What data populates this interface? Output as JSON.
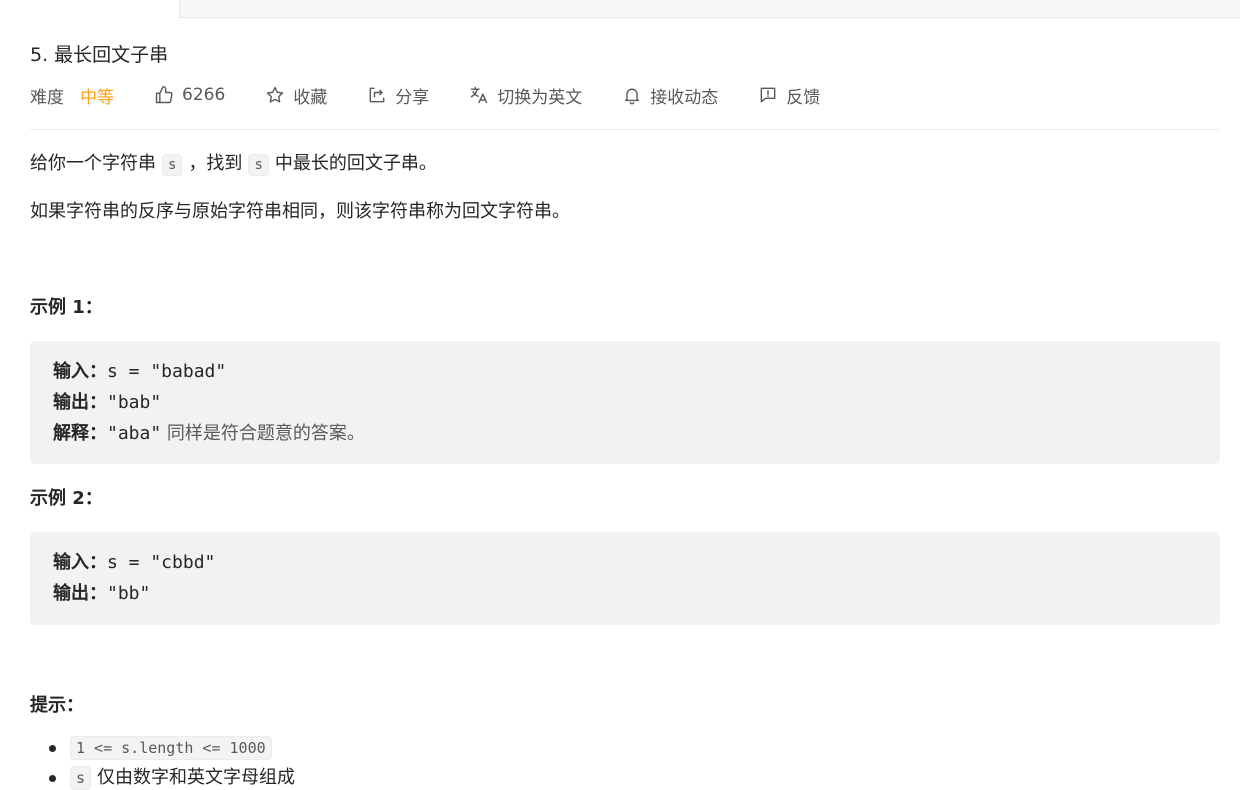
{
  "problem": {
    "title": "5. 最长回文子串",
    "difficulty_label": "难度",
    "difficulty_value": "中等",
    "likes": "6266",
    "actions": {
      "favorite": "收藏",
      "share": "分享",
      "translate": "切换为英文",
      "subscribe": "接收动态",
      "feedback": "反馈"
    }
  },
  "description": {
    "p1_before": "给你一个字符串",
    "p1_code1": "s",
    "p1_middle": "，找到",
    "p1_code2": "s",
    "p1_after": "中最长的回文子串。",
    "p2": "如果字符串的反序与原始字符串相同，则该字符串称为回文字符串。"
  },
  "examples": [
    {
      "title": "示例 1：",
      "input_label": "输入：",
      "input_value": "s = \"babad\"",
      "output_label": "输出：",
      "output_value": "\"bab\"",
      "explain_label": "解释：",
      "explain_value": "\"aba\"",
      "explain_note": " 同样是符合题意的答案。"
    },
    {
      "title": "示例 2：",
      "input_label": "输入：",
      "input_value": "s = \"cbbd\"",
      "output_label": "输出：",
      "output_value": "\"bb\""
    }
  ],
  "hints": {
    "title": "提示：",
    "items": [
      {
        "code": "1 <= s.length <= 1000",
        "text": ""
      },
      {
        "code": "s",
        "text": "仅由数字和英文字母组成"
      }
    ]
  },
  "colors": {
    "difficulty_medium": "#ffa116",
    "text_primary": "#262626",
    "text_secondary": "#595959",
    "code_bg": "#f1f2f4"
  }
}
